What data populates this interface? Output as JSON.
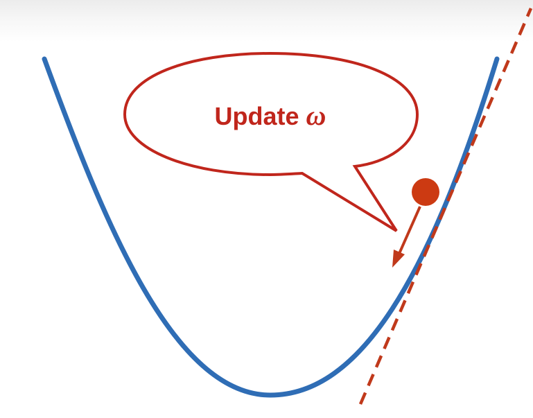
{
  "callout": {
    "text": "Update ",
    "symbol": "ω"
  },
  "colors": {
    "curve": "#2f6db5",
    "accent": "#c0261c",
    "ball": "#cc3a12",
    "tangent": "#c0391b",
    "arrow": "#c0391b"
  }
}
